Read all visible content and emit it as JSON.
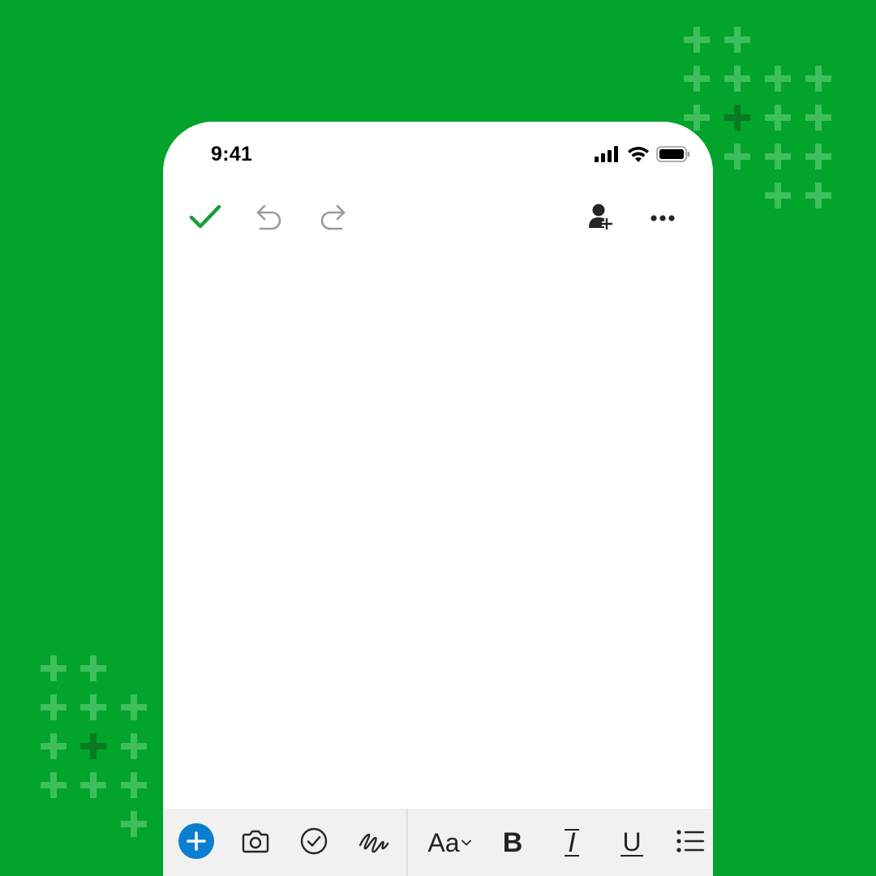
{
  "colors": {
    "background": "#02a42b",
    "accent_check": "#1a9c35",
    "plus_button": "#0a7fcf",
    "icon_dark": "#262626",
    "icon_disabled": "#9a9a9a"
  },
  "status_bar": {
    "time": "9:41",
    "icons": [
      "cellular-signal-icon",
      "wifi-icon",
      "battery-icon"
    ]
  },
  "topbar": {
    "icons": [
      "checkmark-icon",
      "undo-icon",
      "redo-icon",
      "add-person-icon",
      "more-icon"
    ]
  },
  "toolbar": {
    "font_label": "Aa",
    "bold_label": "B",
    "italic_label": "I",
    "underline_label": "U",
    "icons": [
      "plus-icon",
      "camera-icon",
      "checkbox-icon",
      "sketch-icon",
      "chevron-down-icon",
      "bullet-list-icon"
    ]
  }
}
